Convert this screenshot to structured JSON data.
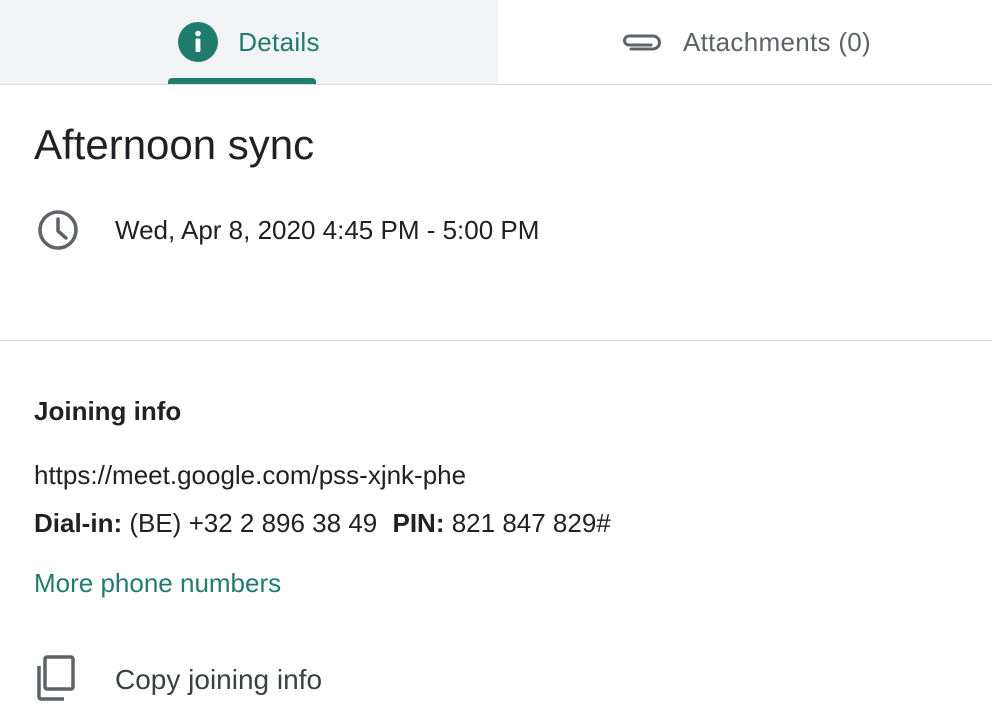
{
  "tabs": {
    "details": {
      "label": "Details",
      "icon": "info-icon",
      "selected": true
    },
    "attachments": {
      "label": "Attachments (0)",
      "icon": "paperclip-icon",
      "selected": false
    }
  },
  "event": {
    "title": "Afternoon sync",
    "datetime": "Wed, Apr 8, 2020 4:45 PM - 5:00 PM"
  },
  "joining": {
    "heading": "Joining info",
    "url": "https://meet.google.com/pss-xjnk-phe",
    "dial_in_label": "Dial-in:",
    "dial_in_value": "(BE) +32 2 896 38 49",
    "pin_label": "PIN:",
    "pin_value": "821 847 829#",
    "more_phones": "More phone numbers",
    "copy_label": "Copy joining info"
  },
  "colors": {
    "accent": "#1e7d6c",
    "text": "#202124",
    "muted": "#5f6368",
    "tab_bg": "#f1f3f4",
    "divider": "#dadce0"
  }
}
